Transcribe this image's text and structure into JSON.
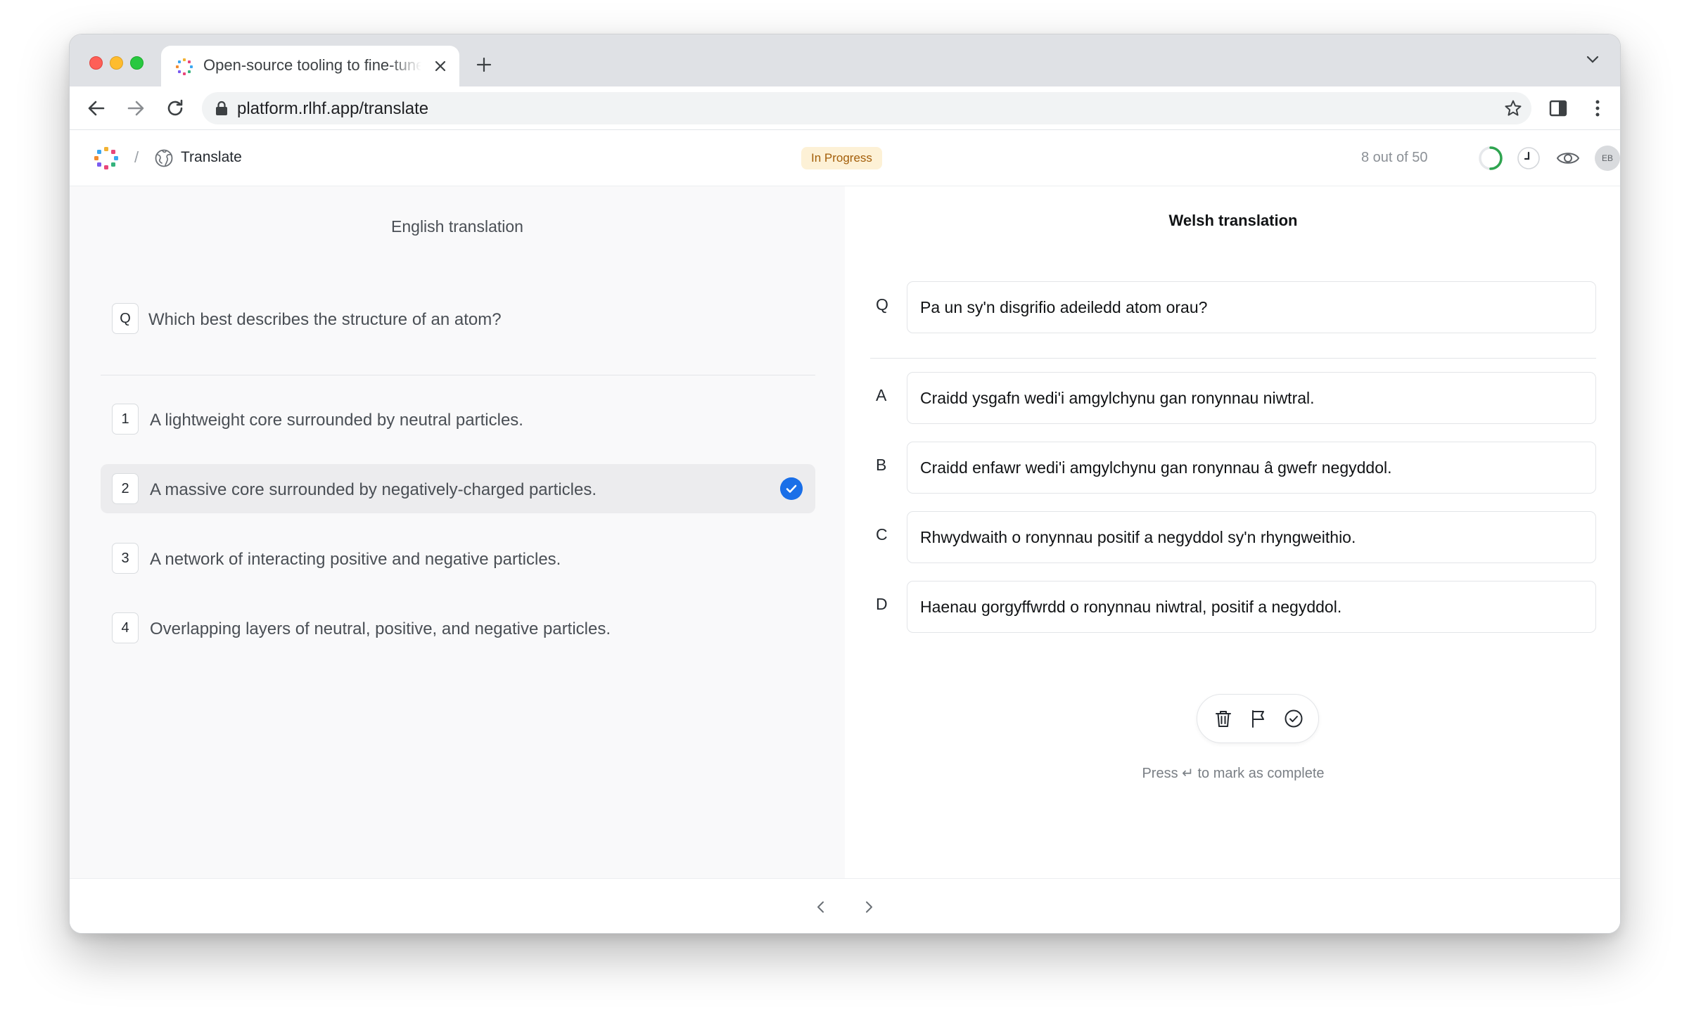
{
  "browser": {
    "tab_title": "Open-source tooling to fine-tune",
    "url": "platform.rlhf.app/translate"
  },
  "header": {
    "breadcrumb_separator": "/",
    "breadcrumb_label": "Translate",
    "status": "In Progress",
    "progress_text": "8 out of 50",
    "progress_fraction": 0.16,
    "avatar_initials": "EB",
    "status_color": "#a35e09"
  },
  "left": {
    "title": "English translation",
    "question": {
      "key": "Q",
      "text": "Which best describes the structure of an atom?"
    },
    "options": [
      {
        "key": "1",
        "text": "A lightweight core surrounded by neutral particles."
      },
      {
        "key": "2",
        "text": "A massive core surrounded by negatively-charged particles.",
        "selected": true
      },
      {
        "key": "3",
        "text": "A network of interacting positive and negative particles."
      },
      {
        "key": "4",
        "text": "Overlapping layers of neutral, positive, and negative particles."
      }
    ]
  },
  "right": {
    "title": "Welsh translation",
    "question": {
      "key": "Q",
      "text": "Pa un sy'n disgrifio adeiledd atom orau?"
    },
    "options": [
      {
        "key": "A",
        "text": "Craidd ysgafn wedi'i amgylchynu gan ronynnau niwtral."
      },
      {
        "key": "B",
        "text": "Craidd enfawr wedi'i amgylchynu gan ronynnau â gwefr negyddol."
      },
      {
        "key": "C",
        "text": "Rhwydwaith o ronynnau positif a negyddol sy'n rhyngweithio."
      },
      {
        "key": "D",
        "text": "Haenau gorgyffwrdd o ronynnau niwtral, positif a negyddol."
      }
    ],
    "hint": "Press ↵ to mark as complete"
  },
  "accent_color": "#1a6fe8"
}
